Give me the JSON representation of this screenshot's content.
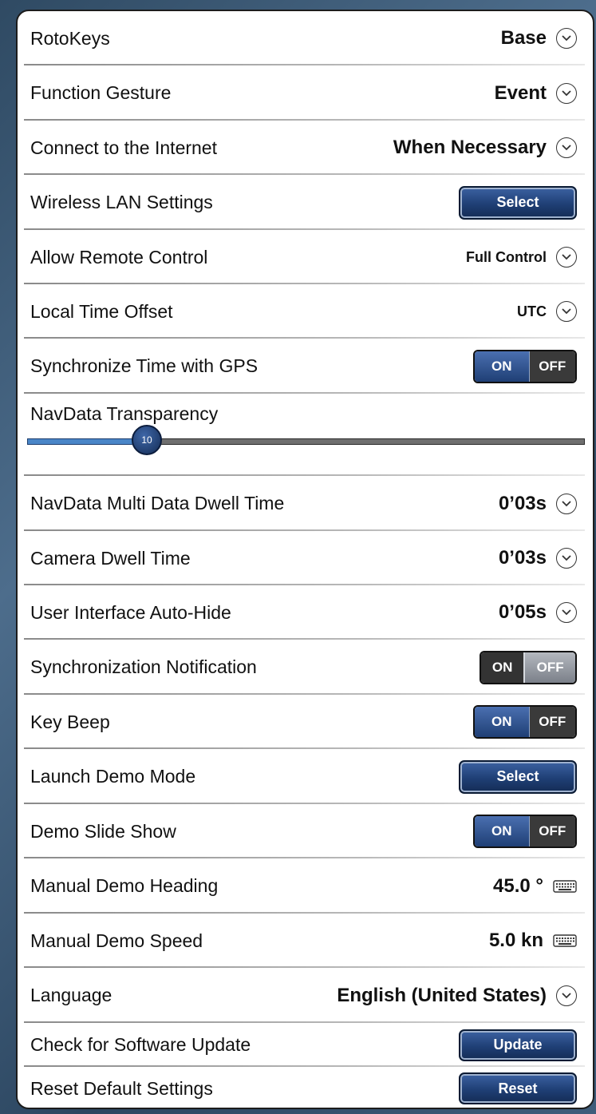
{
  "settings": {
    "rotokeys": {
      "label": "RotoKeys",
      "value": "Base"
    },
    "function_gesture": {
      "label": "Function Gesture",
      "value": "Event"
    },
    "connect_internet": {
      "label": "Connect to the Internet",
      "value": "When Necessary"
    },
    "wireless_lan": {
      "label": "Wireless LAN Settings",
      "button": "Select"
    },
    "remote_control": {
      "label": "Allow Remote Control",
      "value": "Full Control"
    },
    "time_offset": {
      "label": "Local Time Offset",
      "value": "UTC"
    },
    "sync_time_gps": {
      "label": "Synchronize Time with GPS",
      "on": "ON",
      "off": "OFF",
      "state": "on"
    },
    "navdata_transparency": {
      "label": "NavData Transparency",
      "value": "10",
      "fraction": 0.2
    },
    "multi_dwell": {
      "label": "NavData Multi Data Dwell Time",
      "value": "0’03s"
    },
    "camera_dwell": {
      "label": "Camera Dwell Time",
      "value": "0’03s"
    },
    "ui_autohide": {
      "label": "User Interface Auto-Hide",
      "value": "0’05s"
    },
    "sync_notification": {
      "label": "Synchronization Notification",
      "on": "ON",
      "off": "OFF",
      "state": "off"
    },
    "key_beep": {
      "label": "Key Beep",
      "on": "ON",
      "off": "OFF",
      "state": "on"
    },
    "launch_demo": {
      "label": "Launch Demo Mode",
      "button": "Select"
    },
    "demo_slideshow": {
      "label": "Demo Slide Show",
      "on": "ON",
      "off": "OFF",
      "state": "on"
    },
    "demo_heading": {
      "label": "Manual Demo Heading",
      "value": "45.0 °"
    },
    "demo_speed": {
      "label": "Manual Demo Speed",
      "value": "5.0 kn"
    },
    "language": {
      "label": "Language",
      "value": "English (United States)"
    },
    "software_update": {
      "label": "Check for Software Update",
      "button": "Update"
    },
    "reset_defaults": {
      "label": "Reset Default Settings",
      "button": "Reset"
    }
  },
  "icons": {
    "dropdown": "chevron-down-circle-icon",
    "keyboard": "keyboard-icon"
  },
  "colors": {
    "accent": "#1f3f75",
    "slider_fill": "#4a86c8"
  }
}
